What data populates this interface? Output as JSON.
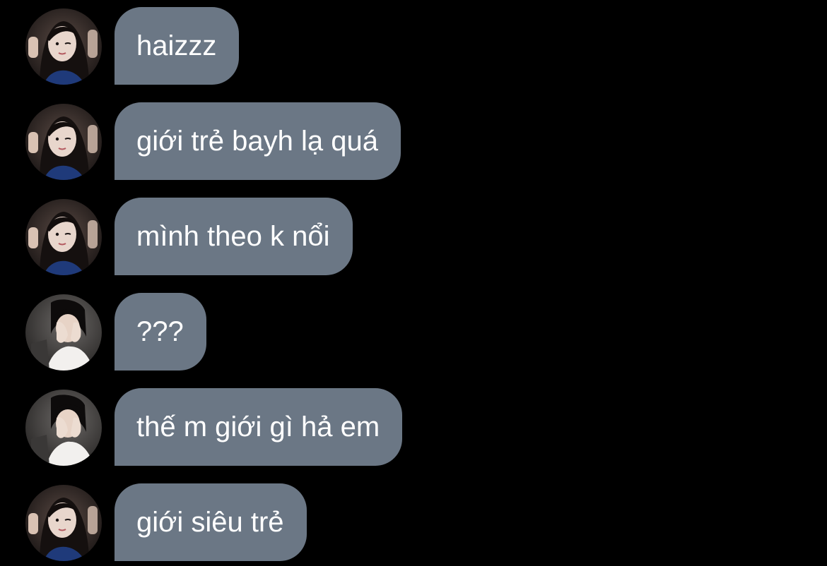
{
  "conversation": {
    "bubble_color": "#6b7785",
    "text_color": "#ffffff",
    "background_color": "#000000",
    "messages": [
      {
        "sender": "user-a",
        "avatar_icon": "profile-photo-dark-hair-woman-icon",
        "text": "haizzz"
      },
      {
        "sender": "user-a",
        "avatar_icon": "profile-photo-dark-hair-woman-icon",
        "text": "giới trẻ bayh lạ quá"
      },
      {
        "sender": "user-a",
        "avatar_icon": "profile-photo-dark-hair-woman-icon",
        "text": "mình theo k nổi"
      },
      {
        "sender": "user-b",
        "avatar_icon": "profile-photo-woman-covering-face-icon",
        "text": "???"
      },
      {
        "sender": "user-b",
        "avatar_icon": "profile-photo-woman-covering-face-icon",
        "text": "thế m giới gì hả em"
      },
      {
        "sender": "user-a",
        "avatar_icon": "profile-photo-dark-hair-woman-icon",
        "text": "giới siêu trẻ"
      }
    ]
  }
}
